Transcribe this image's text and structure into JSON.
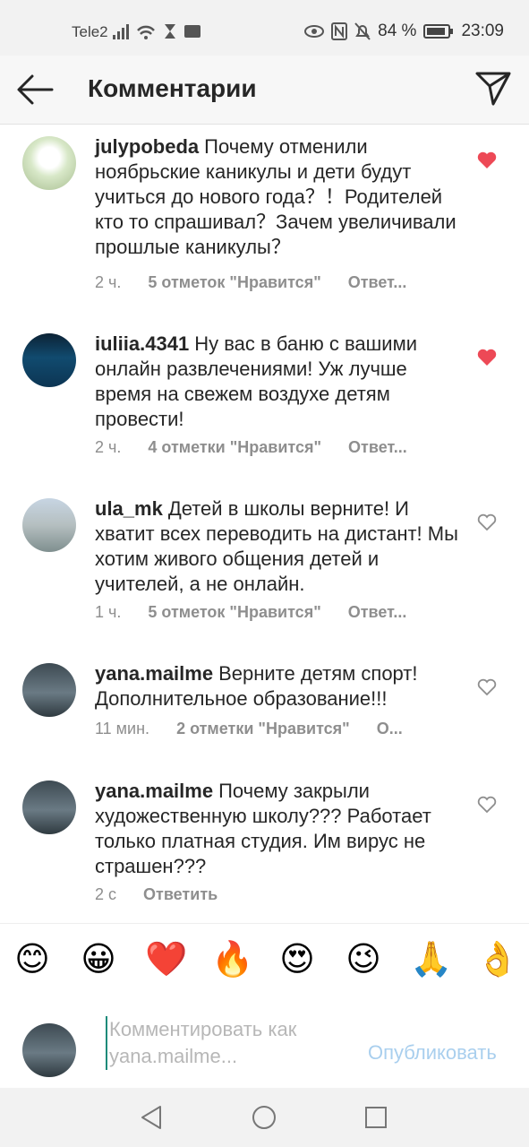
{
  "status_bar": {
    "carrier": "Tele2",
    "battery": "84 %",
    "time": "23:09"
  },
  "header": {
    "title": "Комментарии"
  },
  "comments": [
    {
      "user": "julypobeda",
      "text": "Почему отменили ноябрьские каникулы и дети будут учиться до нового года？！Родителей кто то спрашивал？Зачем увеличивали прошлые каникулы？",
      "time": "2 ч.",
      "likes": "5 отметок \"Нравится\"",
      "reply": "Ответ...",
      "liked": true
    },
    {
      "user": "iuliia.4341",
      "text": "Ну вас в баню с вашими онлайн развлечениями! Уж лучше время на свежем воздухе детям провести!",
      "time": "2 ч.",
      "likes": "4 отметки \"Нравится\"",
      "reply": "Ответ...",
      "liked": true
    },
    {
      "user": "ula_mk",
      "text": "Детей в школы верните! И хватит всех переводить на дистант! Мы хотим живого общения детей и учителей, а не онлайн.",
      "time": "1 ч.",
      "likes": "5 отметок \"Нравится\"",
      "reply": "Ответ...",
      "liked": false
    },
    {
      "user": "yana.mailme",
      "text": "Верните детям спорт! Дополнительное образование!!!",
      "time": "11 мин.",
      "likes": "2 отметки \"Нравится\"",
      "reply": "О...",
      "liked": false
    },
    {
      "user": "yana.mailme",
      "text": "Почему закрыли художественную школу??? Работает только платная студия. Им вирус не страшен???",
      "time": "2 с",
      "likes": "",
      "reply": "Ответить",
      "liked": false
    }
  ],
  "emojis": [
    "😊",
    "😀",
    "❤️",
    "🔥",
    "😍",
    "😉",
    "🙏",
    "👌"
  ],
  "compose": {
    "placeholder": "Комментировать как yana.mailme...",
    "publish": "Опубликовать"
  },
  "colors": {
    "heart_red": "#ed4956",
    "publish_blue": "#a9cfee",
    "meta_gray": "#8e8e8e"
  }
}
